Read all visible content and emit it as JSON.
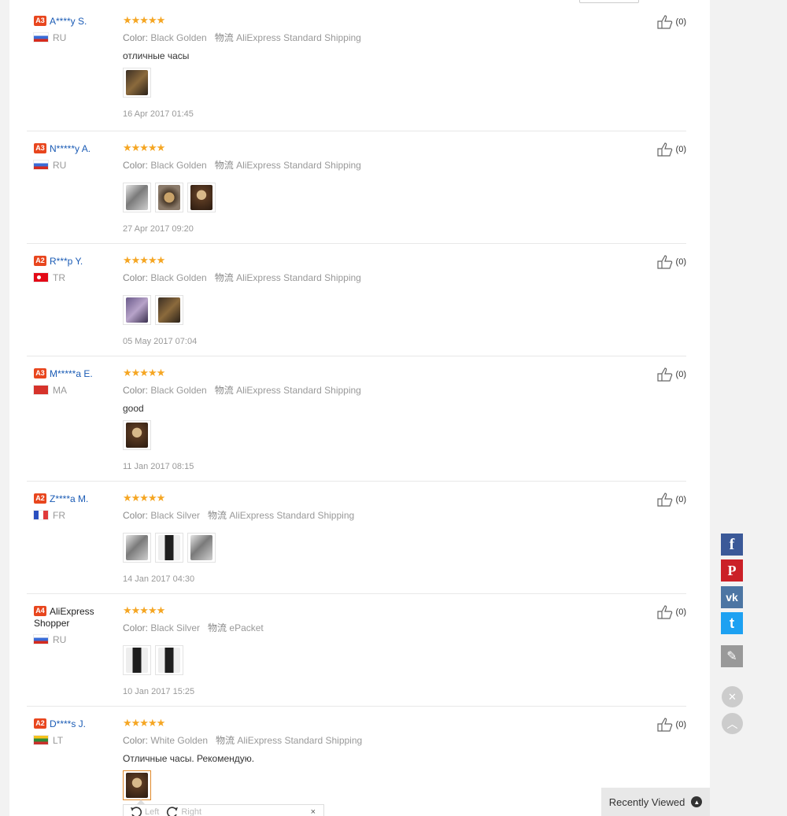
{
  "reviews": [
    {
      "level": "A3",
      "user": "A****y S.",
      "country_code": "RU",
      "flag": "ru",
      "stars": "★★★★★",
      "color_label": "Color:",
      "color": "Black Golden",
      "ship_label": "物流",
      "shipping": "AliExpress Standard Shipping",
      "text": "отличные часы",
      "thumbs": [
        "t-dark"
      ],
      "date": "16 Apr 2017 01:45",
      "likes": "(0)"
    },
    {
      "level": "A3",
      "user": "N*****y A.",
      "country_code": "RU",
      "flag": "ru",
      "stars": "★★★★★",
      "color_label": "Color:",
      "color": "Black Golden",
      "ship_label": "物流",
      "shipping": "AliExpress Standard Shipping",
      "text": "",
      "thumbs": [
        "t-silver",
        "t-gold",
        "t-brown"
      ],
      "date": "27 Apr 2017 09:20",
      "likes": "(0)"
    },
    {
      "level": "A2",
      "user": "R***p Y.",
      "country_code": "TR",
      "flag": "tr",
      "stars": "★★★★★",
      "color_label": "Color:",
      "color": "Black Golden",
      "ship_label": "物流",
      "shipping": "AliExpress Standard Shipping",
      "text": "",
      "thumbs": [
        "t-purple",
        "t-dark"
      ],
      "date": "05 May 2017 07:04",
      "likes": "(0)"
    },
    {
      "level": "A3",
      "user": "M*****a E.",
      "country_code": "MA",
      "flag": "ma",
      "stars": "★★★★★",
      "color_label": "Color:",
      "color": "Black Golden",
      "ship_label": "物流",
      "shipping": "AliExpress Standard Shipping",
      "text": "good",
      "thumbs": [
        "t-brown"
      ],
      "date": "11 Jan 2017 08:15",
      "likes": "(0)"
    },
    {
      "level": "A2",
      "user": "Z****a M.",
      "country_code": "FR",
      "flag": "fr",
      "stars": "★★★★★",
      "color_label": "Color:",
      "color": "Black Silver",
      "ship_label": "物流",
      "shipping": "AliExpress Standard Shipping",
      "text": "",
      "thumbs": [
        "t-silver",
        "t-black",
        "t-silver"
      ],
      "date": "14 Jan 2017 04:30",
      "likes": "(0)"
    },
    {
      "level": "A4",
      "user": "AliExpress Shopper",
      "country_code": "RU",
      "flag": "ru",
      "stars": "★★★★★",
      "color_label": "Color:",
      "color": "Black Silver",
      "ship_label": "物流",
      "shipping": "ePacket",
      "text": "",
      "thumbs": [
        "t-black",
        "t-black"
      ],
      "date": "10 Jan 2017 15:25",
      "likes": "(0)"
    },
    {
      "level": "A2",
      "user": "D****s J.",
      "country_code": "LT",
      "flag": "lt",
      "stars": "★★★★★",
      "color_label": "Color:",
      "color": "White Golden",
      "ship_label": "物流",
      "shipping": "AliExpress Standard Shipping",
      "text": "Отличные часы. Рекомендую.",
      "thumbs": [
        "t-brown"
      ],
      "date": "",
      "likes": "(0)"
    }
  ],
  "viewer": {
    "left_label": "Left",
    "right_label": "Right",
    "close": "×"
  },
  "share": {
    "facebook": "f",
    "pinterest": "P",
    "vk": "vk",
    "twitter": "t",
    "edit": "✎",
    "close": "✕",
    "top": "︿"
  },
  "recently_viewed": "Recently Viewed",
  "colors": {
    "accent": "#e8461e",
    "star": "#f5a623",
    "link": "#1a5bb5",
    "facebook": "#3b5998",
    "pinterest": "#cb2027",
    "vk": "#4c75a3",
    "twitter": "#1da1f2"
  }
}
